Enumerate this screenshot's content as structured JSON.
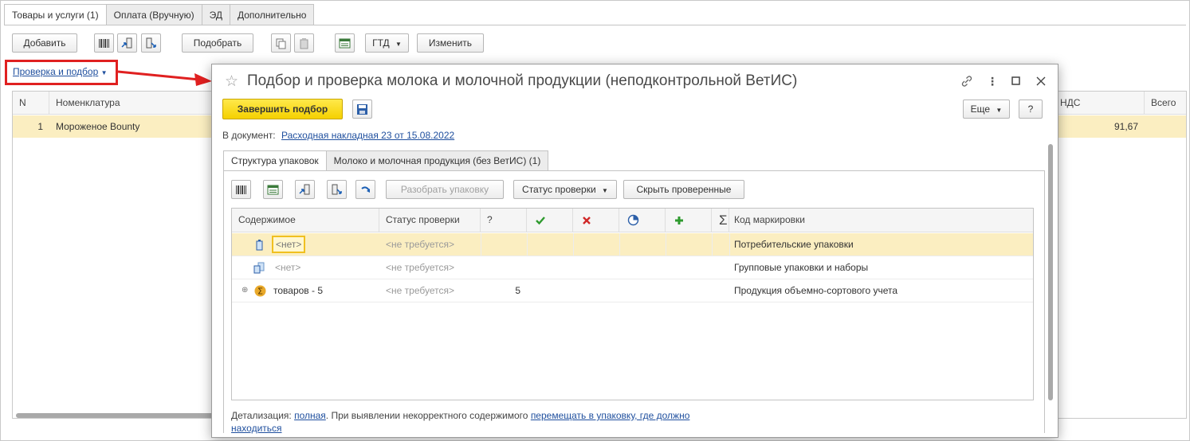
{
  "main_tabs": [
    "Товары и услуги (1)",
    "Оплата (Вручную)",
    "ЭД",
    "Дополнительно"
  ],
  "toolbar": {
    "add": "Добавить",
    "select": "Подобрать",
    "gtd": "ГТД",
    "change": "Изменить"
  },
  "check_link": "Проверка и подбор",
  "table": {
    "headers": [
      "N",
      "Номенклатура",
      "НДС",
      "Всего"
    ],
    "row": {
      "n": "1",
      "name": "Мороженое Bounty",
      "vat": "91,67",
      "total": ""
    }
  },
  "modal": {
    "title": "Подбор и проверка молока и молочной продукции (неподконтрольной ВетИС)",
    "finish": "Завершить подбор",
    "more": "Еще",
    "help": "?",
    "doc_label": "В документ:",
    "doc_link": "Расходная накладная 23 от 15.08.2022",
    "tabs": [
      "Структура упаковок",
      "Молоко и молочная продукция (без ВетИС) (1)"
    ],
    "unpack": "Разобрать упаковку",
    "check_status": "Статус проверки",
    "hide_checked": "Скрыть проверенные",
    "columns": {
      "content": "Содержимое",
      "status": "Статус проверки",
      "question": "?",
      "sigma": "Σ",
      "code": "Код маркировки"
    },
    "rows": [
      {
        "content": "<нет>",
        "status": "<не требуется>",
        "q": "",
        "code": "Потребительские упаковки"
      },
      {
        "content": "<нет>",
        "status": "<не требуется>",
        "q": "",
        "code": "Групповые упаковки и наборы"
      },
      {
        "content": "товаров - 5",
        "status": "<не требуется>",
        "q": "5",
        "code": "Продукция объемно-сортового учета"
      }
    ],
    "detail_label": "Детализация:",
    "detail_link": "полная",
    "detail_text": ". При выявлении некорректного содержимого",
    "detail_link2": "перемещать в упаковку, где должно находиться"
  },
  "colors": {
    "accent_yellow": "#f5d100",
    "selection": "#fbeec1",
    "link": "#1f4f9e",
    "callout": "#e02020"
  }
}
